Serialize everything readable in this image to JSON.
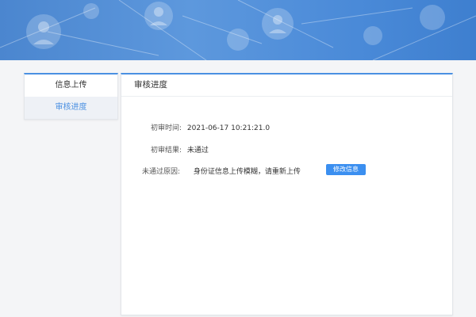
{
  "sidebar": {
    "items": [
      {
        "label": "信息上传"
      },
      {
        "label": "审核进度"
      }
    ]
  },
  "panel": {
    "title": "审核进度",
    "fields": {
      "review_time_label": "初审时间:",
      "review_time_value": "2021-06-17 10:21:21.0",
      "review_result_label": "初审结果:",
      "review_result_value": "未通过",
      "reject_reason_label": "未通过原因:",
      "reject_reason_value": "身份证信息上传模糊，请重新上传"
    },
    "modify_button": "修改信息"
  },
  "colors": {
    "accent": "#4a90e2",
    "button": "#3b8ff0",
    "banner": "#5d98dd"
  }
}
